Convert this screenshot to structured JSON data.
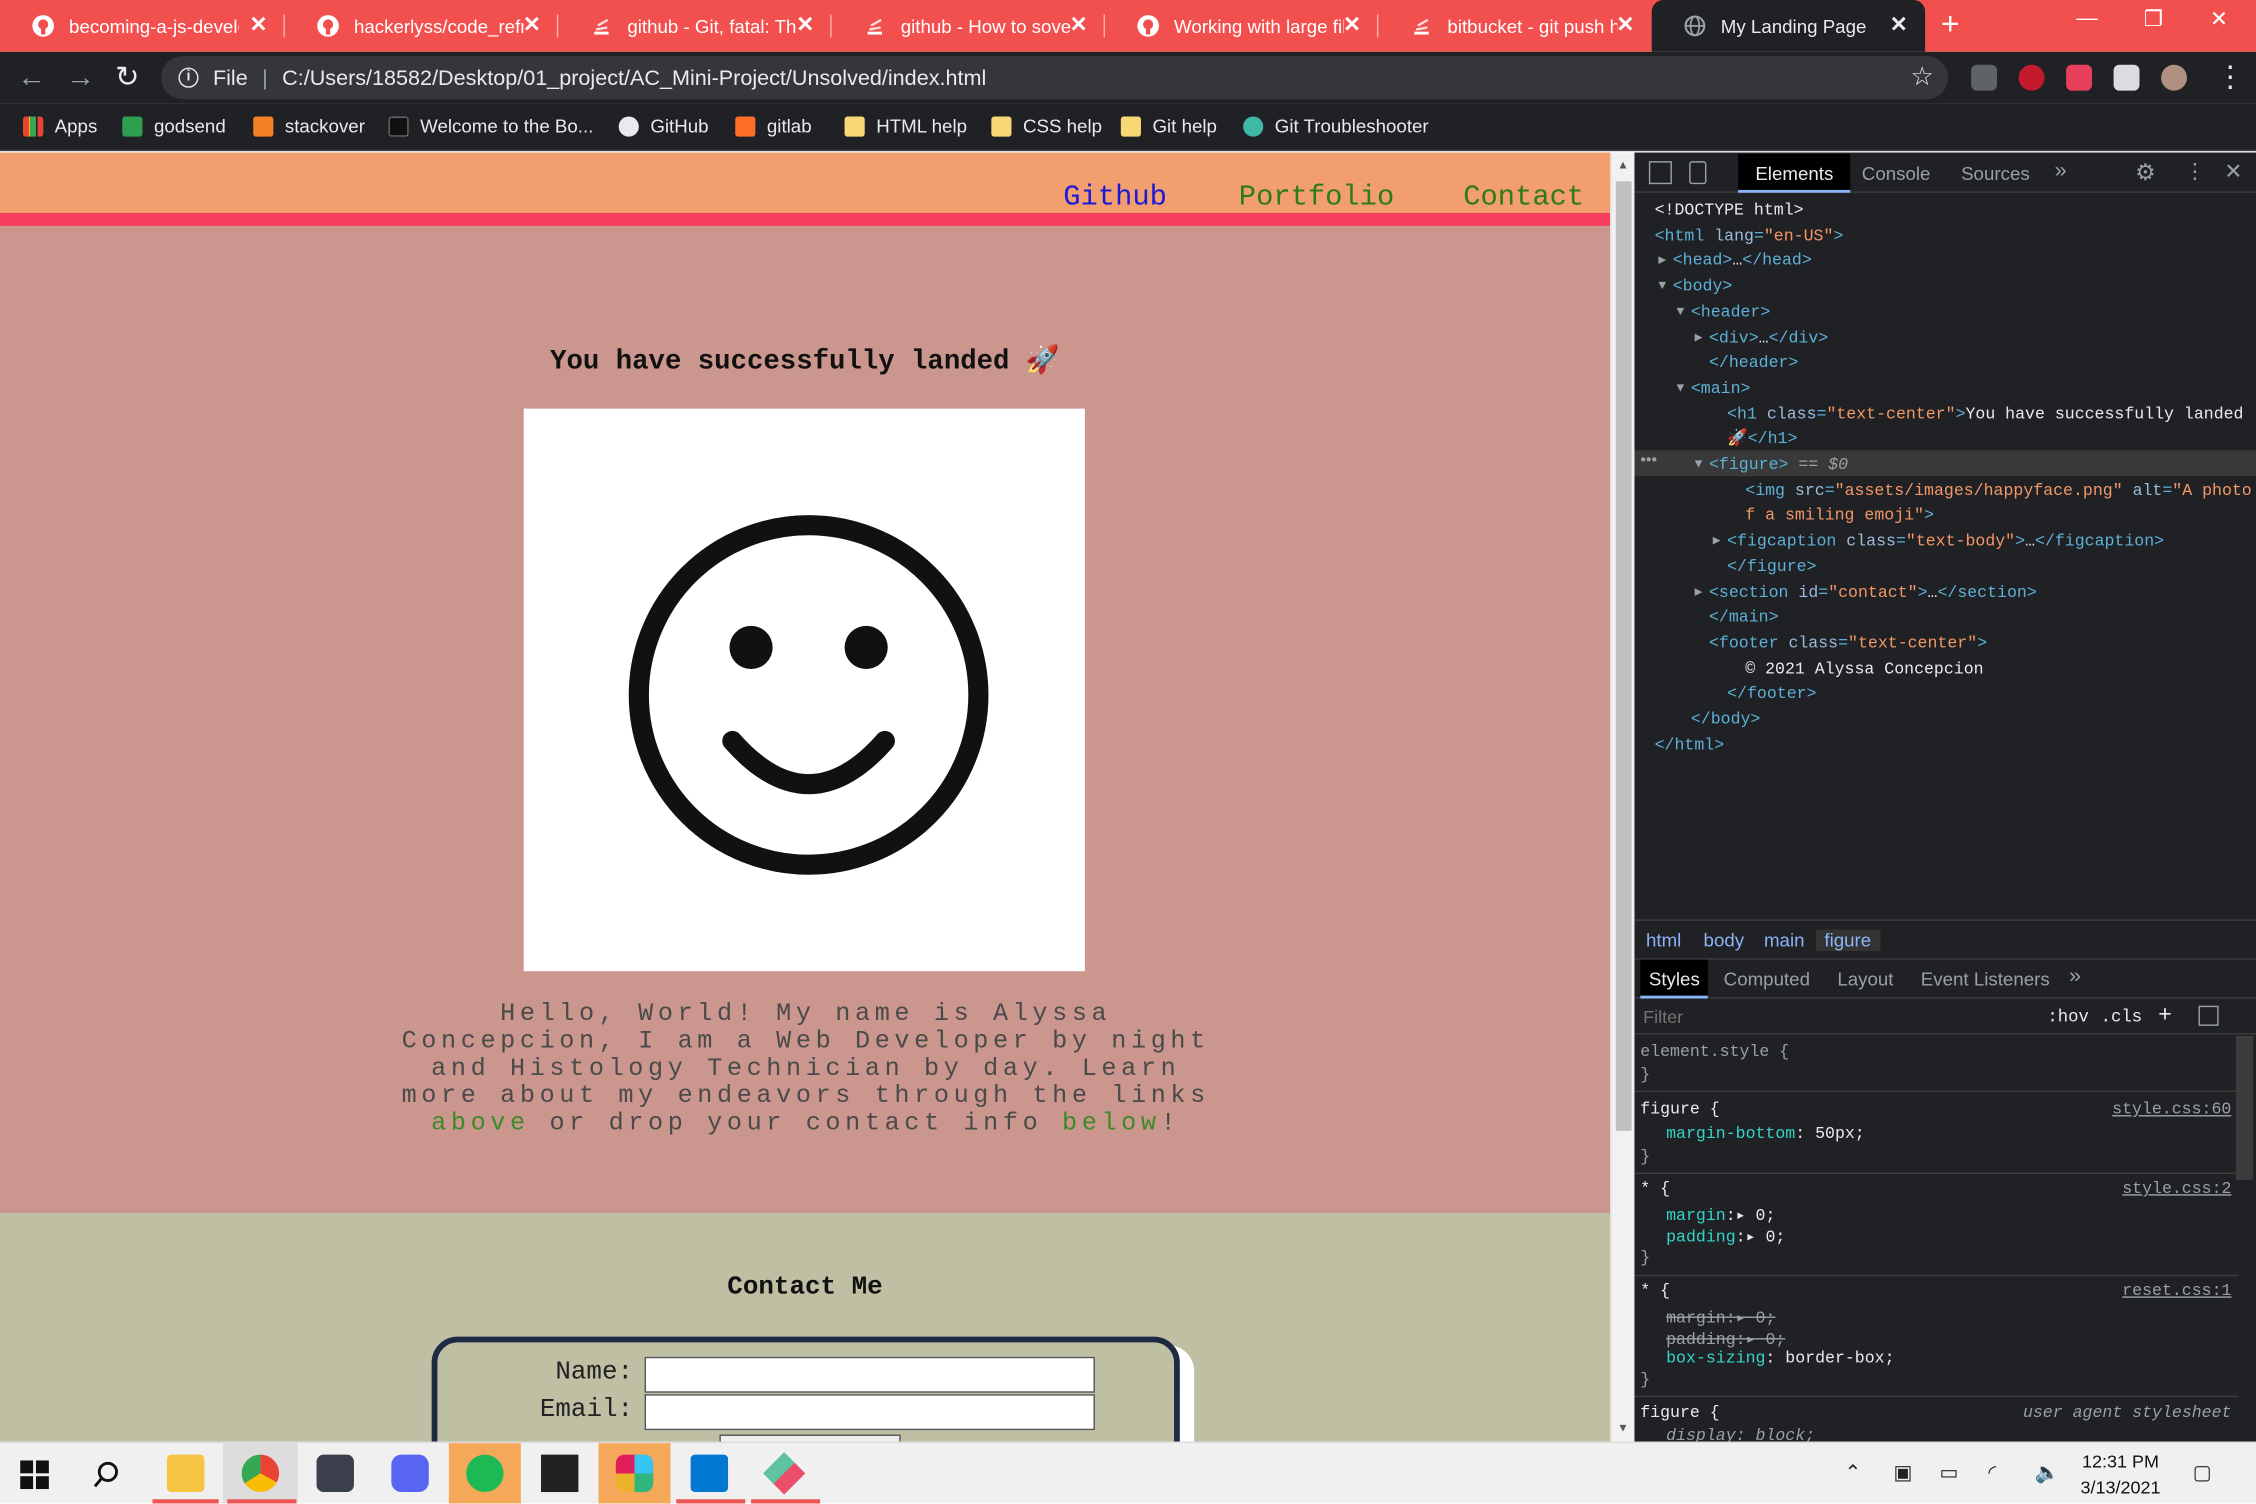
{
  "browser": {
    "tabs": [
      {
        "title": "becoming-a-js-develo",
        "favicon": "github-icon"
      },
      {
        "title": "hackerlyss/code_refrac",
        "favicon": "github-icon"
      },
      {
        "title": "github - Git, fatal: The",
        "favicon": "stackoverflow-icon"
      },
      {
        "title": "github - How to sove",
        "favicon": "stackoverflow-icon"
      },
      {
        "title": "Working with large file",
        "favicon": "github-icon"
      },
      {
        "title": "bitbucket - git push h",
        "favicon": "stackoverflow-icon"
      },
      {
        "title": "My Landing Page",
        "favicon": "globe-icon",
        "active": true
      }
    ],
    "address": {
      "scheme_label": "File",
      "url": "C:/Users/18582/Desktop/01_project/AC_Mini-Project/Unsolved/index.html"
    },
    "bookmarks": [
      {
        "label": "Apps",
        "icon": "apps-grid-icon"
      },
      {
        "label": "godsend",
        "icon": "w-icon"
      },
      {
        "label": "stackover",
        "icon": "stackoverflow-icon"
      },
      {
        "label": "Welcome to the Bo...",
        "icon": "book-icon"
      },
      {
        "label": "GitHub",
        "icon": "github-icon"
      },
      {
        "label": "gitlab",
        "icon": "gitlab-icon"
      },
      {
        "label": "HTML help",
        "icon": "folder-icon"
      },
      {
        "label": "CSS help",
        "icon": "folder-icon"
      },
      {
        "label": "Git help",
        "icon": "folder-icon"
      },
      {
        "label": "Git Troubleshooter",
        "icon": "git-icon"
      }
    ]
  },
  "page": {
    "nav": [
      {
        "label": "Github",
        "color": "#1a1ad6"
      },
      {
        "label": "Portfolio",
        "color": "#2d7d12"
      },
      {
        "label": "Contact",
        "color": "#2d7d12"
      }
    ],
    "heading": "You have successfully landed 🚀",
    "image_alt": "A photo of a smiling emoji",
    "caption": {
      "text_before": "Hello, World! My name is Alyssa Concepcion, I am a Web Developer by night and Histology Technician by day. Learn more about my endeavors through the links ",
      "link_above": "above",
      "text_middle": " or drop your contact info ",
      "link_below": "below",
      "text_after": "!"
    },
    "contact": {
      "title": "Contact Me",
      "name_label": "Name:",
      "email_label": "Email:"
    },
    "colors": {
      "header_bg": "#f29e6f",
      "header_border": "#f73d5e",
      "main_bg": "#cb968d",
      "contact_bg": "#bfbfa4"
    }
  },
  "devtools": {
    "tabs": [
      "Elements",
      "Console",
      "Sources"
    ],
    "dom_lines": [
      {
        "indent": 0,
        "arrow": "",
        "parts": [
          [
            "tx",
            "<!DOCTYPE html>"
          ]
        ]
      },
      {
        "indent": 0,
        "arrow": "",
        "parts": [
          [
            "tag",
            "<html "
          ],
          [
            "an",
            "lang"
          ],
          [
            "tag",
            "="
          ],
          [
            "av",
            "\"en-US\""
          ],
          [
            "tag",
            ">"
          ]
        ]
      },
      {
        "indent": 1,
        "arrow": "▶",
        "parts": [
          [
            "tag",
            "<head>"
          ],
          [
            "tx",
            "…"
          ],
          [
            "tag",
            "</head>"
          ]
        ]
      },
      {
        "indent": 1,
        "arrow": "▼",
        "parts": [
          [
            "tag",
            "<body>"
          ]
        ]
      },
      {
        "indent": 2,
        "arrow": "▼",
        "parts": [
          [
            "tag",
            "<header>"
          ]
        ]
      },
      {
        "indent": 3,
        "arrow": "▶",
        "parts": [
          [
            "tag",
            "<div>"
          ],
          [
            "tx",
            "…"
          ],
          [
            "tag",
            "</div>"
          ]
        ]
      },
      {
        "indent": 3,
        "arrow": "",
        "parts": [
          [
            "tag",
            "</header>"
          ]
        ]
      },
      {
        "indent": 2,
        "arrow": "▼",
        "parts": [
          [
            "tag",
            "<main>"
          ]
        ]
      },
      {
        "indent": 4,
        "arrow": "",
        "parts": [
          [
            "tag",
            "<h1 "
          ],
          [
            "an",
            "class"
          ],
          [
            "tag",
            "="
          ],
          [
            "av",
            "\"text-center\""
          ],
          [
            "tag",
            ">"
          ],
          [
            "tx",
            "You have successfully landed"
          ]
        ]
      },
      {
        "indent": 4,
        "arrow": "",
        "parts": [
          [
            "tx",
            "🚀"
          ],
          [
            "tag",
            "</h1>"
          ]
        ]
      },
      {
        "indent": 3,
        "arrow": "▼",
        "selected": true,
        "parts": [
          [
            "tag",
            "<figure>"
          ],
          [
            "cm",
            " == $0"
          ]
        ]
      },
      {
        "indent": 5,
        "arrow": "",
        "parts": [
          [
            "tag",
            "<img "
          ],
          [
            "an",
            "src"
          ],
          [
            "tag",
            "="
          ],
          [
            "av",
            "\"assets/images/happyface.png\""
          ],
          [
            "an",
            " alt"
          ],
          [
            "tag",
            "="
          ],
          [
            "av",
            "\"A photo o"
          ]
        ]
      },
      {
        "indent": 5,
        "arrow": "",
        "parts": [
          [
            "av",
            "f a smiling emoji\""
          ],
          [
            "tag",
            ">"
          ]
        ]
      },
      {
        "indent": 4,
        "arrow": "▶",
        "parts": [
          [
            "tag",
            "<figcaption "
          ],
          [
            "an",
            "class"
          ],
          [
            "tag",
            "="
          ],
          [
            "av",
            "\"text-body\""
          ],
          [
            "tag",
            ">"
          ],
          [
            "tx",
            "…"
          ],
          [
            "tag",
            "</figcaption>"
          ]
        ]
      },
      {
        "indent": 4,
        "arrow": "",
        "parts": [
          [
            "tag",
            "</figure>"
          ]
        ]
      },
      {
        "indent": 3,
        "arrow": "▶",
        "parts": [
          [
            "tag",
            "<section "
          ],
          [
            "an",
            "id"
          ],
          [
            "tag",
            "="
          ],
          [
            "av",
            "\"contact\""
          ],
          [
            "tag",
            ">"
          ],
          [
            "tx",
            "…"
          ],
          [
            "tag",
            "</section>"
          ]
        ]
      },
      {
        "indent": 3,
        "arrow": "",
        "parts": [
          [
            "tag",
            "</main>"
          ]
        ]
      },
      {
        "indent": 3,
        "arrow": "",
        "parts": [
          [
            "tag",
            "<footer "
          ],
          [
            "an",
            "class"
          ],
          [
            "tag",
            "="
          ],
          [
            "av",
            "\"text-center\""
          ],
          [
            "tag",
            ">"
          ]
        ]
      },
      {
        "indent": 5,
        "arrow": "",
        "parts": [
          [
            "tx",
            "© 2021 Alyssa Concepcion"
          ]
        ]
      },
      {
        "indent": 4,
        "arrow": "",
        "parts": [
          [
            "tag",
            "</footer>"
          ]
        ]
      },
      {
        "indent": 2,
        "arrow": "",
        "parts": [
          [
            "tag",
            "</body>"
          ]
        ]
      },
      {
        "indent": 0,
        "arrow": "",
        "parts": [
          [
            "tag",
            "</html>"
          ]
        ]
      }
    ],
    "breadcrumbs": [
      "html",
      "body",
      "main",
      "figure"
    ],
    "style_tabs": [
      "Styles",
      "Computed",
      "Layout",
      "Event Listeners"
    ],
    "filter_placeholder": "Filter",
    "hov": ":hov",
    "cls": ".cls",
    "rules": {
      "element_style": "element.style {",
      "figure_selector": "figure",
      "figure_src": "style.css:60",
      "figure_prop": "margin-bottom",
      "figure_val": "50px;",
      "star_selector": "*",
      "star_src": "style.css:2",
      "star_margin": "margin",
      "star_padding": "padding",
      "zero": "0;",
      "reset_src": "reset.css:1",
      "box_sizing": "box-sizing",
      "border_box": "border-box;",
      "ua_selector": "figure",
      "ua_label": "user agent stylesheet",
      "display": "display",
      "block": "block;"
    }
  },
  "taskbar": {
    "time": "12:31 PM",
    "date": "3/13/2021"
  }
}
